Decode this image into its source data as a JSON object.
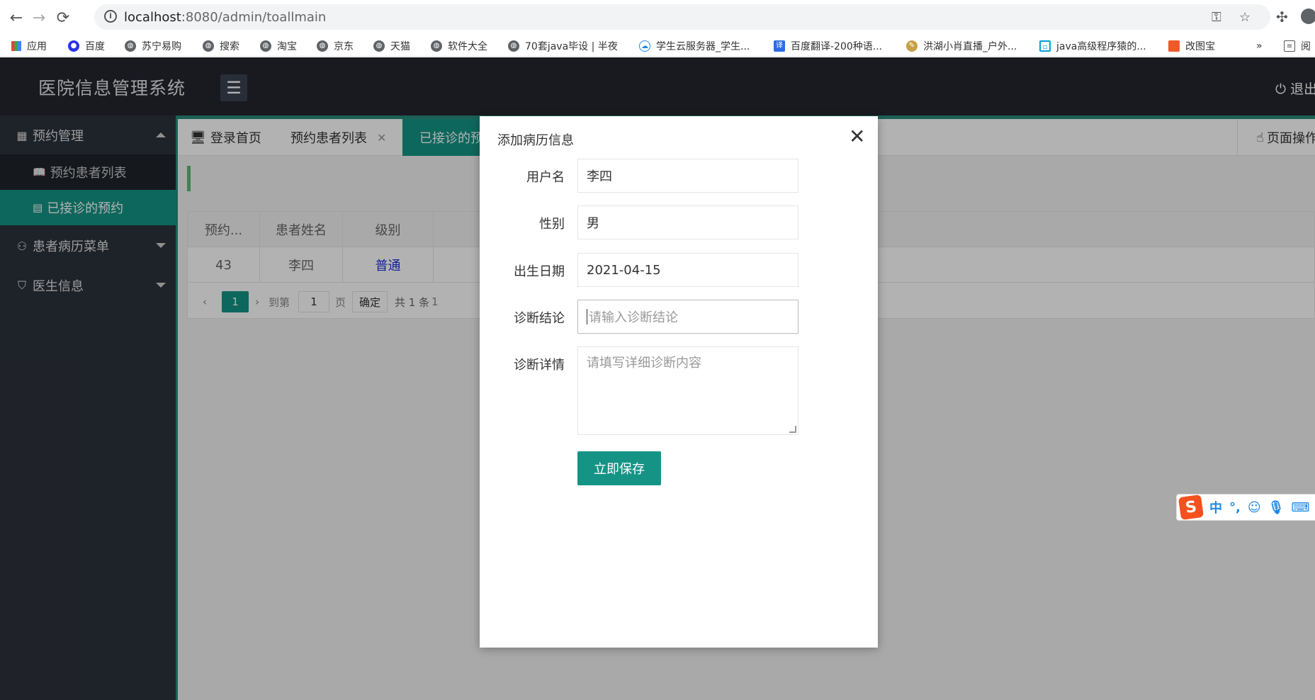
{
  "browser": {
    "url_host": "localhost",
    "url_path": ":8080/admin/toallmain",
    "bookmarks": [
      {
        "label": "应用"
      },
      {
        "label": "百度"
      },
      {
        "label": "苏宁易购"
      },
      {
        "label": "搜索"
      },
      {
        "label": "淘宝"
      },
      {
        "label": "京东"
      },
      {
        "label": "天猫"
      },
      {
        "label": "软件大全"
      },
      {
        "label": "70套java毕设 | 半夜"
      },
      {
        "label": "学生云服务器_学生..."
      },
      {
        "label": "百度翻译-200种语..."
      },
      {
        "label": "洪湖小肖直播_户外..."
      },
      {
        "label": "java高级程序猿的..."
      },
      {
        "label": "改图宝"
      }
    ],
    "more_label": "»",
    "reading_label": "阅"
  },
  "header": {
    "title": "医院信息管理系统",
    "logout_label": "退出"
  },
  "sidebar": {
    "groups": [
      {
        "label": "预约管理"
      },
      {
        "label": "患者病历菜单"
      },
      {
        "label": "医生信息"
      }
    ],
    "subitems": [
      {
        "label": "预约患者列表"
      },
      {
        "label": "已接诊的预约"
      }
    ]
  },
  "tabs": {
    "items": [
      {
        "label": "登录首页"
      },
      {
        "label": "预约患者列表"
      },
      {
        "label": "已接诊的预"
      }
    ],
    "page_ops_label": "页面操作"
  },
  "table": {
    "headers": [
      "预约...",
      "患者姓名",
      "级别"
    ],
    "rows": [
      [
        "43",
        "李四",
        "普通"
      ]
    ],
    "pager": {
      "current": "1",
      "goto_label": "到第",
      "goto_value": "1",
      "page_label": "页",
      "confirm_label": "确定",
      "total_label": "共 1 条",
      "size_fragment": "1"
    }
  },
  "modal": {
    "title": "添加病历信息",
    "close_symbol": "✕",
    "fields": {
      "username_label": "用户名",
      "username_value": "李四",
      "gender_label": "性别",
      "gender_value": "男",
      "birth_label": "出生日期",
      "birth_value": "2021-04-15",
      "diagnosis_label": "诊断结论",
      "diagnosis_placeholder": "请输入诊断结论",
      "detail_label": "诊断详情",
      "detail_placeholder": "请填写详细诊断内容"
    },
    "save_label": "立即保存"
  },
  "ime": {
    "logo": "S",
    "lang": "中",
    "punct": "°,"
  },
  "colors": {
    "accent": "#159486",
    "header_bg": "#23262e",
    "sidebar_bg": "#2c313b",
    "link": "#1a2fd6"
  }
}
